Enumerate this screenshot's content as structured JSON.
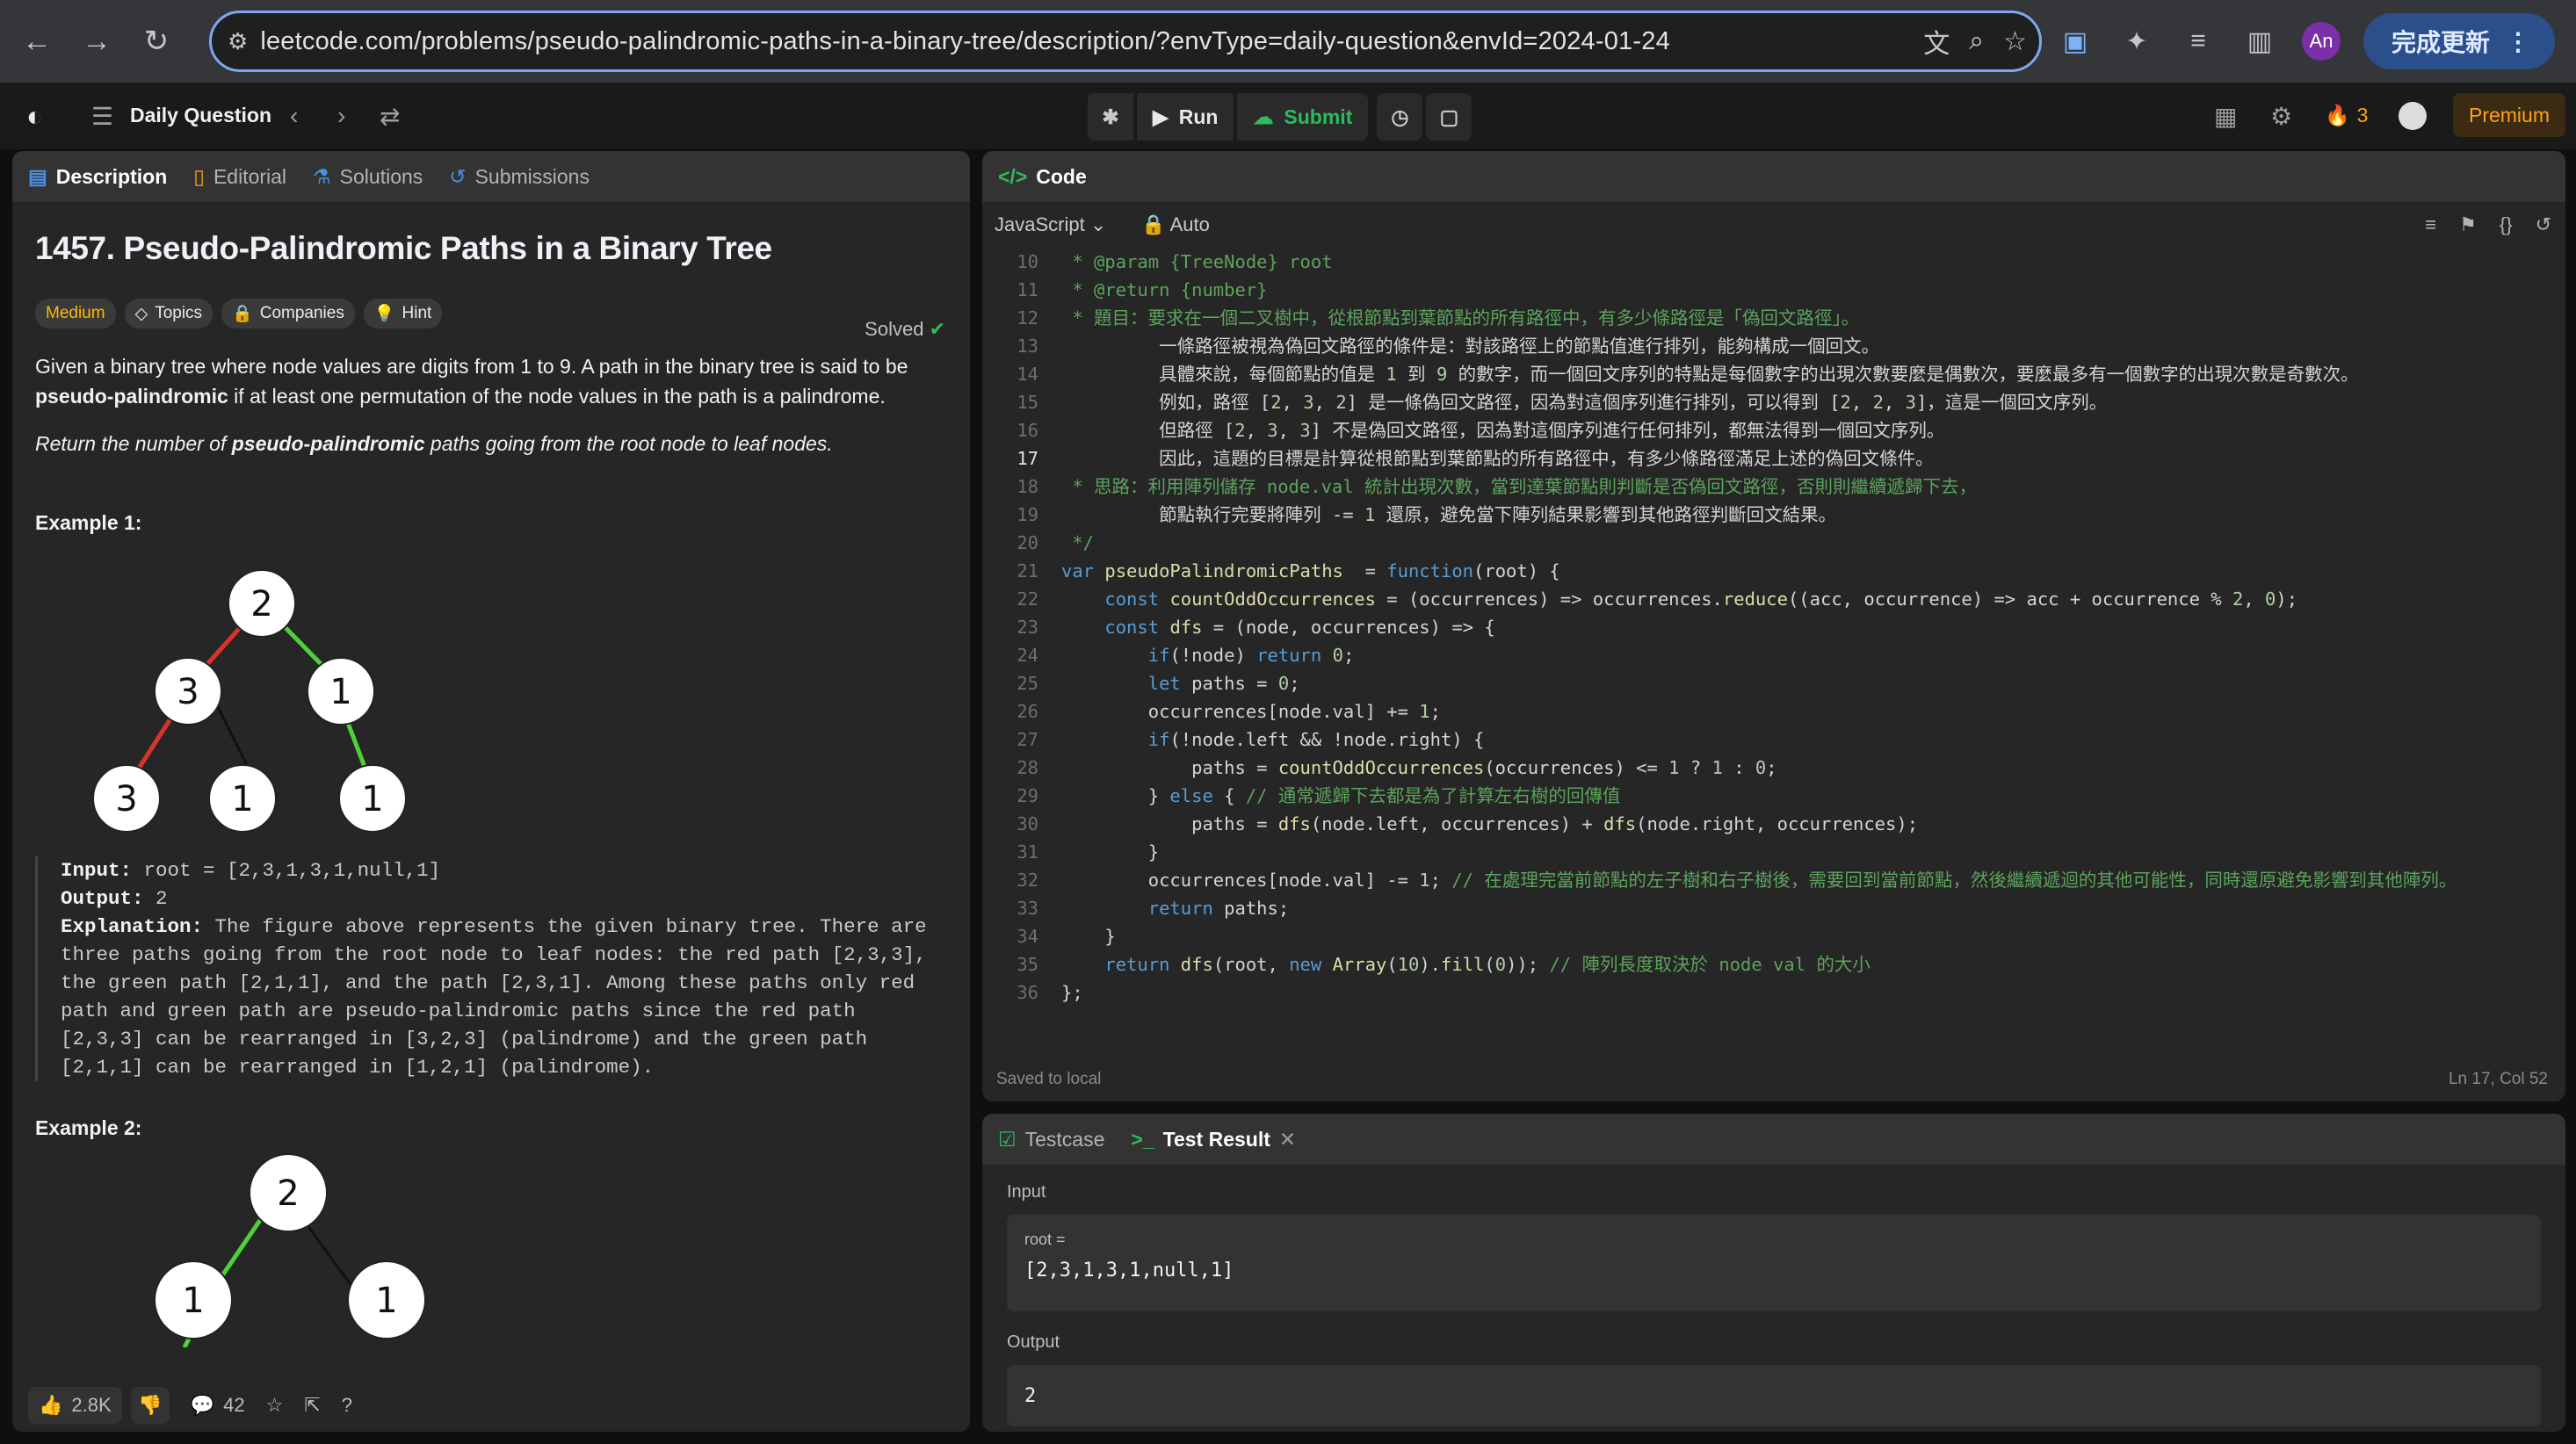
{
  "browser": {
    "url": "leetcode.com/problems/pseudo-palindromic-paths-in-a-binary-tree/description/?envType=daily-question&envId=2024-01-24",
    "profile": "An",
    "update_button": "完成更新"
  },
  "nav": {
    "daily_question": "Daily Question",
    "run": "Run",
    "submit": "Submit",
    "streak": "3",
    "premium": "Premium"
  },
  "left_tabs": [
    "Description",
    "Editorial",
    "Solutions",
    "Submissions"
  ],
  "problem": {
    "title": "1457. Pseudo-Palindromic Paths in a Binary Tree",
    "status": "Solved",
    "difficulty": "Medium",
    "tags": [
      "Topics",
      "Companies",
      "Hint"
    ],
    "p1_a": "Given a binary tree where node values are digits from 1 to 9. A path in the binary tree is said to be ",
    "p1_b": "pseudo-palindromic",
    "p1_c": " if at least one permutation of the node values in the path is a palindrome.",
    "p2_a": "Return the number of ",
    "p2_b": "pseudo-palindromic",
    "p2_c": " paths going from the root node to leaf nodes.",
    "example1_title": "Example 1:",
    "example1_tree": [
      "2",
      "3",
      "1",
      "3",
      "1",
      "1"
    ],
    "example1_input_label": "Input:",
    "example1_input": "root = [2,3,1,3,1,null,1]",
    "example1_output_label": "Output:",
    "example1_output": "2",
    "example1_expl_label": "Explanation:",
    "example1_expl": "The figure above represents the given binary tree. There are three paths going from the root node to leaf nodes: the red path [2,3,3], the green path [2,1,1], and the path [2,3,1]. Among these paths only red path and green path are pseudo-palindromic paths since the red path [2,3,3] can be rearranged in [3,2,3] (palindrome) and the green path [2,1,1] can be rearranged in [1,2,1] (palindrome).",
    "example2_title": "Example 2:",
    "example2_tree": [
      "2",
      "1",
      "1"
    ],
    "likes": "2.8K",
    "comments": "42"
  },
  "code": {
    "tab": "Code",
    "language": "JavaScript",
    "mode": "Auto",
    "saved": "Saved to local",
    "cursor": "Ln 17, Col 52",
    "lines": [
      {
        "n": "10",
        "t": " * @param {TreeNode} root"
      },
      {
        "n": "11",
        "t": " * @return {number}"
      },
      {
        "n": "12",
        "t": " * 題目：要求在一個二叉樹中，從根節點到葉節點的所有路徑中，有多少條路徑是「偽回文路徑」。"
      },
      {
        "n": "13",
        "t": "         一條路徑被視為偽回文路徑的條件是：對該路徑上的節點值進行排列，能夠構成一個回文。"
      },
      {
        "n": "14",
        "t": "         具體來說，每個節點的值是 1 到 9 的數字，而一個回文序列的特點是每個數字的出現次數要麼是偶數次，要麼最多有一個數字的出現次數是奇數次。"
      },
      {
        "n": "15",
        "t": "         例如，路徑 [2, 3, 2] 是一條偽回文路徑，因為對這個序列進行排列，可以得到 [2, 2, 3]，這是一個回文序列。"
      },
      {
        "n": "16",
        "t": "         但路徑 [2, 3, 3] 不是偽回文路徑，因為對這個序列進行任何排列，都無法得到一個回文序列。"
      },
      {
        "n": "17",
        "t": "         因此，這題的目標是計算從根節點到葉節點的所有路徑中，有多少條路徑滿足上述的偽回文條件。"
      },
      {
        "n": "18",
        "t": " * 思路：利用陣列儲存 node.val 統計出現次數，當到達葉節點則判斷是否偽回文路徑，否則則繼續遞歸下去，"
      },
      {
        "n": "19",
        "t": "         節點執行完要將陣列 -= 1 還原，避免當下陣列結果影響到其他路徑判斷回文結果。"
      },
      {
        "n": "20",
        "t": " */"
      },
      {
        "n": "21",
        "t": "var pseudoPalindromicPaths  = function(root) {"
      },
      {
        "n": "22",
        "t": "    const countOddOccurrences = (occurrences) => occurrences.reduce((acc, occurrence) => acc + occurrence % 2, 0);"
      },
      {
        "n": "23",
        "t": "    const dfs = (node, occurrences) => {"
      },
      {
        "n": "24",
        "t": "        if(!node) return 0;"
      },
      {
        "n": "25",
        "t": "        let paths = 0;"
      },
      {
        "n": "26",
        "t": "        occurrences[node.val] += 1;"
      },
      {
        "n": "27",
        "t": "        if(!node.left && !node.right) {"
      },
      {
        "n": "28",
        "t": "            paths = countOddOccurrences(occurrences) <= 1 ? 1 : 0;"
      },
      {
        "n": "29",
        "t": "        } else { // 通常遞歸下去都是為了計算左右樹的回傳值"
      },
      {
        "n": "30",
        "t": "            paths = dfs(node.left, occurrences) + dfs(node.right, occurrences);"
      },
      {
        "n": "31",
        "t": "        }"
      },
      {
        "n": "32",
        "t": "        occurrences[node.val] -= 1; // 在處理完當前節點的左子樹和右子樹後，需要回到當前節點，然後繼續遞迴的其他可能性，同時還原避免影響到其他陣列。"
      },
      {
        "n": "33",
        "t": "        return paths;"
      },
      {
        "n": "34",
        "t": "    }"
      },
      {
        "n": "35",
        "t": "    return dfs(root, new Array(10).fill(0)); // 陣列長度取決於 node val 的大小"
      },
      {
        "n": "36",
        "t": "};"
      }
    ]
  },
  "result": {
    "tab_testcase": "Testcase",
    "tab_result": "Test Result",
    "input_label": "Input",
    "param_name": "root =",
    "param_value": "[2,3,1,3,1,null,1]",
    "output_label": "Output",
    "output_value": "2"
  }
}
